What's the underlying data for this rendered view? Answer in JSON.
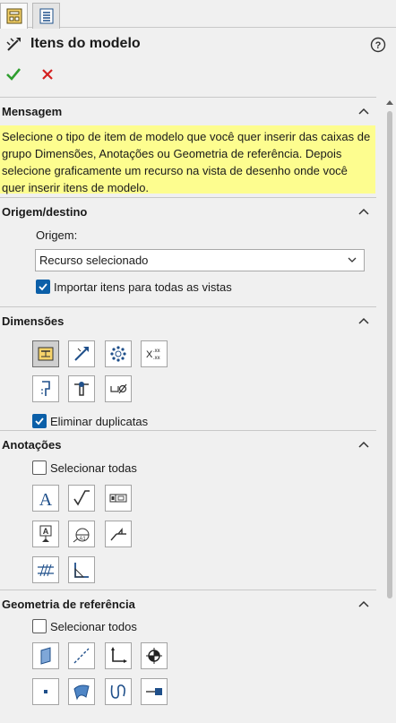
{
  "panel": {
    "title": "Itens do modelo",
    "ok_icon": "check-icon",
    "cancel_icon": "close-icon"
  },
  "message": {
    "title": "Mensagem",
    "text": "Selecione o tipo de item de modelo que você quer inserir das caixas de grupo Dimensões, Anotações ou Geometria de referência. Depois selecione graficamente um recurso na vista de desenho onde você quer inserir itens de modelo."
  },
  "source": {
    "title": "Origem/destino",
    "origin_label": "Origem:",
    "origin_value": "Recurso selecionado",
    "import_all_label": "Importar itens para todas as vistas",
    "import_all_checked": true
  },
  "dimensions": {
    "title": "Dimensões",
    "eliminate_duplicates_label": "Eliminar duplicatas",
    "eliminate_duplicates_checked": true
  },
  "annotations": {
    "title": "Anotações",
    "select_all_label": "Selecionar todas",
    "select_all_checked": false
  },
  "reference_geometry": {
    "title": "Geometria de referência",
    "select_all_label": "Selecionar todos",
    "select_all_checked": false
  },
  "colors": {
    "message_bg": "#fdfd8f",
    "check_blue": "#0b5fa8",
    "ok_green": "#2e9e2e",
    "cancel_red": "#d42020"
  }
}
